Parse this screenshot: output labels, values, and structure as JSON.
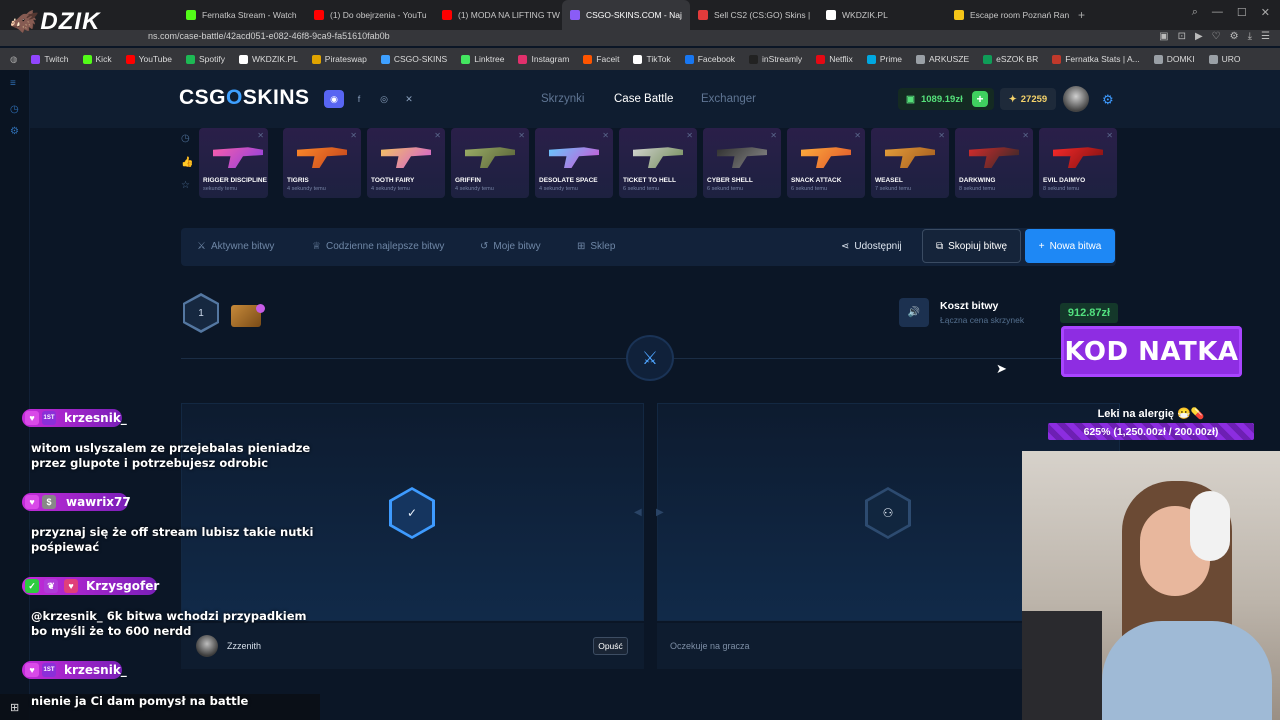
{
  "overlay_logo": "DZIK",
  "browser": {
    "tabs": [
      {
        "label": "Fernatka Stream - Watch",
        "color": "#53fc18"
      },
      {
        "label": "(1) Do obejrzenia - YouTu",
        "color": "#ff0000"
      },
      {
        "label": "(1) MODA NA LIFTING TW",
        "color": "#ff0000"
      },
      {
        "label": "CSGO-SKINS.COM - Naj",
        "color": "#8a5cf6",
        "active": true
      },
      {
        "label": "Sell CS2 (CS:GO) Skins |",
        "color": "#e23b3b"
      },
      {
        "label": "WKDZIK.PL",
        "color": "#ffffff"
      },
      {
        "label": "Escape room Poznań Ran",
        "color": "#f5c518"
      }
    ],
    "url": "ns.com/case-battle/42acd051-e082-46f8-9ca9-fa51610fab0b",
    "bookmarks": [
      {
        "label": "Twitch",
        "color": "#9146ff"
      },
      {
        "label": "Kick",
        "color": "#53fc18"
      },
      {
        "label": "YouTube",
        "color": "#ff0000"
      },
      {
        "label": "Spotify",
        "color": "#1db954"
      },
      {
        "label": "WKDZIK.PL",
        "color": "#ffffff"
      },
      {
        "label": "Pirateswap",
        "color": "#e0a400"
      },
      {
        "label": "CSGO-SKINS",
        "color": "#3ea0ff"
      },
      {
        "label": "Linktree",
        "color": "#43e660"
      },
      {
        "label": "Instagram",
        "color": "#e1306c"
      },
      {
        "label": "Faceit",
        "color": "#ff5500"
      },
      {
        "label": "TikTok",
        "color": "#ffffff"
      },
      {
        "label": "Facebook",
        "color": "#1877f2"
      },
      {
        "label": "inStreamly",
        "color": "#222222"
      },
      {
        "label": "Netflix",
        "color": "#e50914"
      },
      {
        "label": "Prime",
        "color": "#00a8e1"
      },
      {
        "label": "ARKUSZE",
        "color": "#9aa0a6"
      },
      {
        "label": "eSZOK BR",
        "color": "#0f9d58"
      },
      {
        "label": "Fernatka Stats | A...",
        "color": "#c0392b"
      },
      {
        "label": "DOMKI",
        "color": "#9aa0a6"
      },
      {
        "label": "URO",
        "color": "#9aa0a6"
      }
    ]
  },
  "site": {
    "logo_main": "CSG",
    "logo_o": "O",
    "logo_rest": "SKINS",
    "nav": [
      "Skrzynki",
      "Case Battle",
      "Exchanger"
    ],
    "balance": "1089.19zł",
    "coins": "27259",
    "accent": "#1e88f5"
  },
  "drops": [
    {
      "name": "RIGGER DISCIPLINE",
      "sub": "sekundy temu",
      "c1": "#ff5fa8",
      "c2": "#8b3fe0"
    },
    {
      "name": "TIGRIS",
      "sub": "4 sekundy temu",
      "c1": "#ff8c2a",
      "c2": "#c2421c"
    },
    {
      "name": "TOOTH FAIRY",
      "sub": "4 sekundy temu",
      "c1": "#f6c95b",
      "c2": "#d15ad6"
    },
    {
      "name": "GRIFFIN",
      "sub": "4 sekundy temu",
      "c1": "#9fb36a",
      "c2": "#565f36"
    },
    {
      "name": "DESOLATE SPACE",
      "sub": "4 sekundy temu",
      "c1": "#5fd0ff",
      "c2": "#d24fd3"
    },
    {
      "name": "TICKET TO HELL",
      "sub": "6 sekund temu",
      "c1": "#d8d8d8",
      "c2": "#6f8a55"
    },
    {
      "name": "CYBER SHELL",
      "sub": "6 sekund temu",
      "c1": "#2a2a2a",
      "c2": "#8a8a8a"
    },
    {
      "name": "SNACK ATTACK",
      "sub": "6 sekund temu",
      "c1": "#ffb23e",
      "c2": "#e0542a"
    },
    {
      "name": "WEASEL",
      "sub": "7 sekund temu",
      "c1": "#e8a23c",
      "c2": "#a2591d"
    },
    {
      "name": "DARKWING",
      "sub": "8 sekund temu",
      "c1": "#e02b2b",
      "c2": "#2a2a2a"
    },
    {
      "name": "EVIL DAIMYO",
      "sub": "8 sekund temu",
      "c1": "#ff2b2b",
      "c2": "#7a1010"
    }
  ],
  "actions": {
    "active": "Aktywne bitwy",
    "best": "Codzienne najlepsze bitwy",
    "mine": "Moje bitwy",
    "shop": "Sklep",
    "share": "Udostępnij",
    "copy": "Skopiuj bitwę",
    "new": "Nowa bitwa"
  },
  "battle": {
    "round": "1",
    "cost_title": "Koszt bitwy",
    "cost_sub": "Łączna cena skrzynek",
    "cost_value": "912.87zł",
    "player1": "Zzzenith",
    "leave": "Opuść",
    "waiting": "Oczekuje na gracza"
  },
  "overlay": {
    "kod": "KOD NATKA",
    "goal_title": "Leki na alergię 😷💊",
    "goal_progress": "625% (1,250.00zł / 200.00zł)",
    "goal_fraction": 6.25
  },
  "chat": [
    {
      "user": "krzesnik_",
      "badge": "1ST",
      "msg": "witom uslyszalem ze przejebalas pieniadze przez glupote i potrzebujesz odrobic"
    },
    {
      "user": "wawrix77",
      "badge": "",
      "msg": "przyznaj się że off stream lubisz takie nutki pośpiewać"
    },
    {
      "user": "Krzysgofer",
      "badge": "",
      "msg": "@krzesnik_ 6k bitwa wchodzi przypadkiem bo myśli że to 600 nerdd"
    },
    {
      "user": "krzesnik_",
      "badge": "1ST",
      "msg": "nienie ja Ci dam pomysł na battle"
    }
  ]
}
